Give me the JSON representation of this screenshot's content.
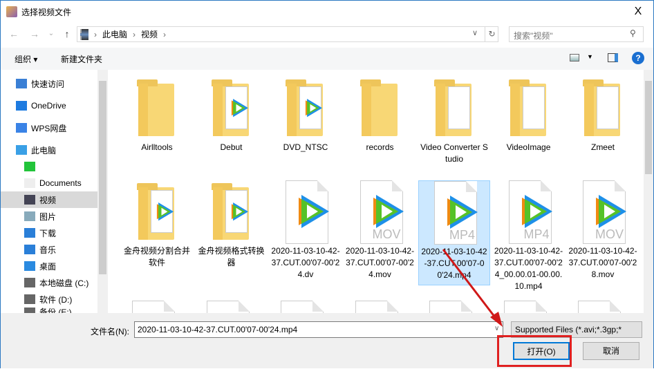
{
  "window": {
    "title": "选择视频文件",
    "close": "X"
  },
  "nav": {
    "back": "←",
    "forward": "→",
    "recent": "⌄",
    "up": "↑",
    "breadcrumb": [
      "此电脑",
      "视频"
    ],
    "separator": "›",
    "refresh": "↻",
    "search_placeholder": "搜索\"视频\""
  },
  "toolbar": {
    "organize": "组织 ▾",
    "new_folder": "新建文件夹",
    "help": "?"
  },
  "sidebar": {
    "items": [
      {
        "label": "快速访问",
        "icon": "star-icon"
      },
      {
        "label": "OneDrive",
        "icon": "cloud-icon"
      },
      {
        "label": "WPS网盘",
        "icon": "wps-cloud-icon"
      },
      {
        "label": "此电脑",
        "icon": "computer-icon"
      },
      {
        "label": "",
        "icon": "iqiyi-icon"
      },
      {
        "label": "Documents",
        "icon": "document-icon"
      },
      {
        "label": "视频",
        "icon": "video-icon"
      },
      {
        "label": "图片",
        "icon": "picture-icon"
      },
      {
        "label": "下载",
        "icon": "download-icon"
      },
      {
        "label": "音乐",
        "icon": "music-icon"
      },
      {
        "label": "桌面",
        "icon": "desktop-icon"
      },
      {
        "label": "本地磁盘 (C:)",
        "icon": "drive-icon"
      },
      {
        "label": "软件 (D:)",
        "icon": "drive-icon"
      },
      {
        "label": "备份 (E:)",
        "icon": "drive-icon"
      }
    ]
  },
  "files": [
    {
      "name": "Airlltools",
      "type": "folder"
    },
    {
      "name": "Debut",
      "type": "folder"
    },
    {
      "name": "DVD_NTSC",
      "type": "folder"
    },
    {
      "name": "records",
      "type": "folder"
    },
    {
      "name": "Video Converter Studio",
      "type": "folder"
    },
    {
      "name": "VideoImage",
      "type": "folder"
    },
    {
      "name": "Zmeet",
      "type": "folder"
    },
    {
      "name": "金舟视频分割合并软件",
      "type": "folder"
    },
    {
      "name": "金舟视频格式转换器",
      "type": "folder"
    },
    {
      "name": "2020-11-03-10-42-37.CUT.00'07-00'24.dv",
      "type": "file",
      "ext": ""
    },
    {
      "name": "2020-11-03-10-42-37.CUT.00'07-00'24.mov",
      "type": "file",
      "ext": "MOV"
    },
    {
      "name": "2020-11-03-10-42-37.CUT.00'07-00'24.mp4",
      "type": "file",
      "ext": "MP4",
      "selected": true
    },
    {
      "name": "2020-11-03-10-42-37.CUT.00'07-00'24_00.00.01-00.00.10.mp4",
      "type": "file",
      "ext": "MP4"
    },
    {
      "name": "2020-11-03-10-42-37.CUT.00'07-00'28.mov",
      "type": "file",
      "ext": "MOV"
    }
  ],
  "footer": {
    "filename_label": "文件名(N):",
    "filename_value": "2020-11-03-10-42-37.CUT.00'07-00'24.mp4",
    "filter": "Supported Files (*.avi;*.3gp;*",
    "open": "打开(O)",
    "cancel": "取消"
  },
  "colors": {
    "accent": "#0078d7",
    "highlight": "#e02020",
    "selection": "#cce8ff"
  }
}
